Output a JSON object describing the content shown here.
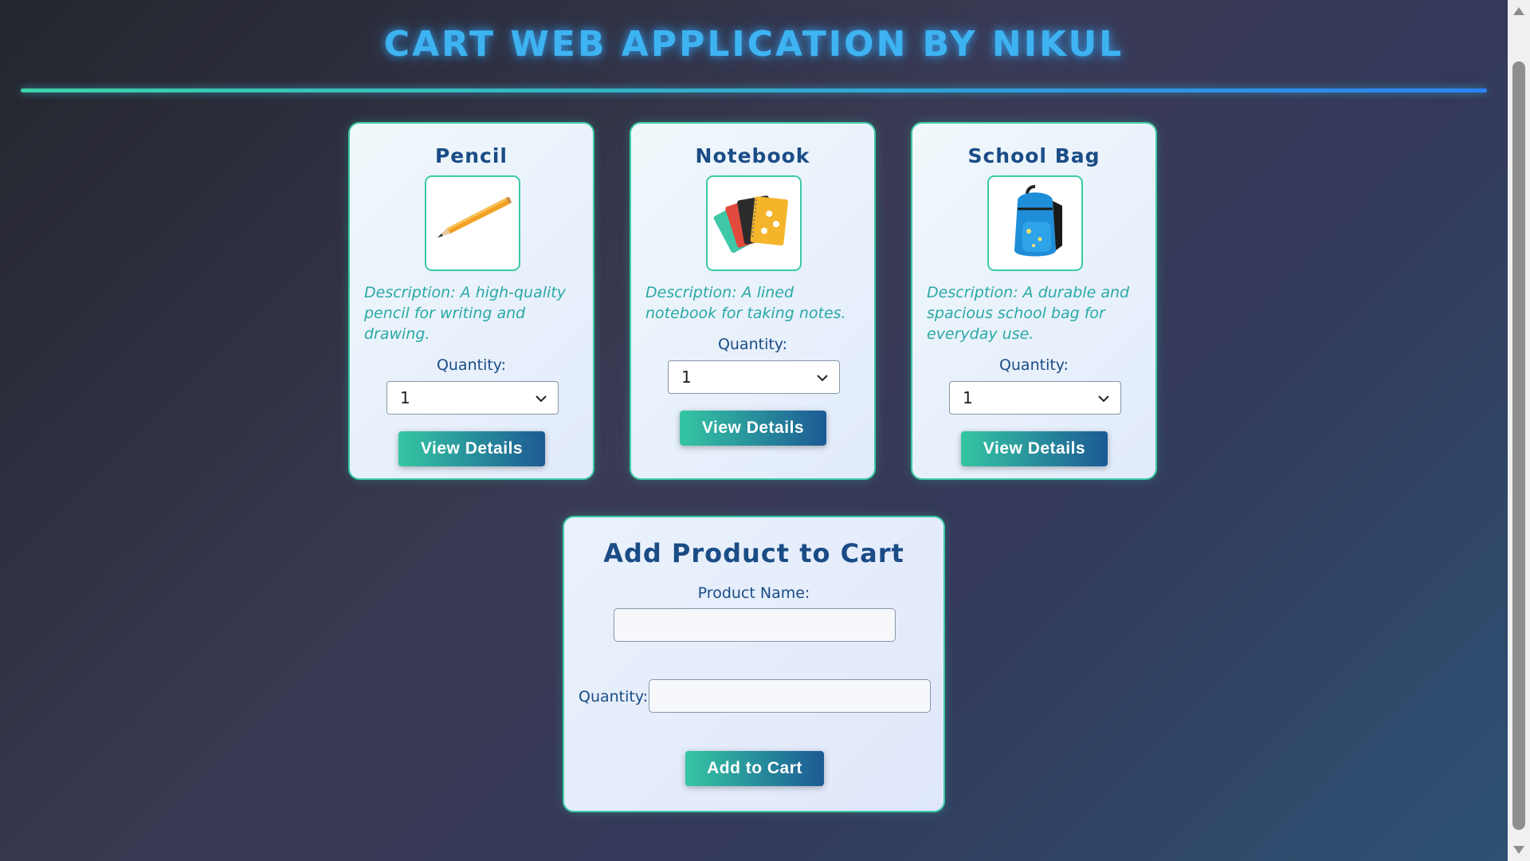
{
  "header": {
    "title": "CART WEB APPLICATION BY NIKUL"
  },
  "products": [
    {
      "name": "Pencil",
      "icon": "pencil-image",
      "description": "Description: A high-quality pencil for writing and drawing.",
      "quantity_label": "Quantity:",
      "quantity_value": "1",
      "button_label": "View Details"
    },
    {
      "name": "Notebook",
      "icon": "notebook-image",
      "description": "Description: A lined notebook for taking notes.",
      "quantity_label": "Quantity:",
      "quantity_value": "1",
      "button_label": "View Details"
    },
    {
      "name": "School Bag",
      "icon": "school-bag-image",
      "description": "Description: A durable and spacious school bag for everyday use.",
      "quantity_label": "Quantity:",
      "quantity_value": "1",
      "button_label": "View Details"
    }
  ],
  "form": {
    "title": "Add Product to Cart",
    "product_name_label": "Product Name:",
    "product_name_value": "",
    "quantity_label": "Quantity:",
    "quantity_value": "",
    "submit_label": "Add to Cart"
  },
  "colors": {
    "title": "#3eb3f2",
    "accent_teal": "#3cc9a5",
    "accent_blue": "#1c5a95",
    "heading_text": "#1a4c86",
    "description_text": "#29a9a6"
  }
}
